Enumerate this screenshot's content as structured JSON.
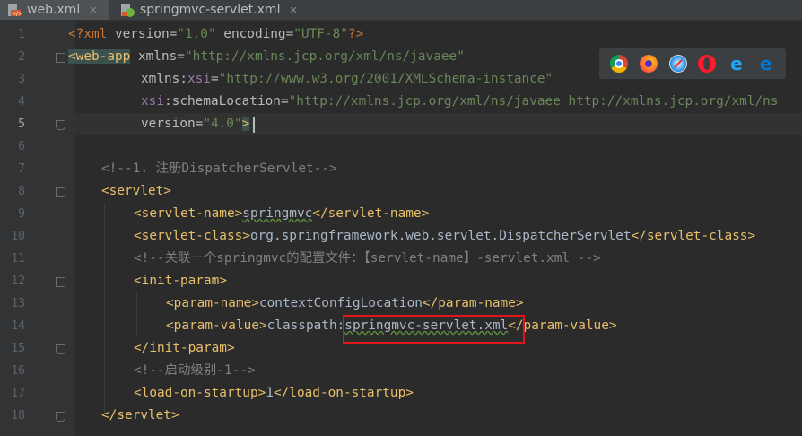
{
  "tabs": [
    {
      "label": "web.xml",
      "active": true
    },
    {
      "label": "springmvc-servlet.xml",
      "active": false
    }
  ],
  "line_numbers": [
    "1",
    "2",
    "3",
    "4",
    "5",
    "6",
    "7",
    "8",
    "9",
    "10",
    "11",
    "12",
    "13",
    "14",
    "15",
    "16",
    "17",
    "18"
  ],
  "current_line": "5",
  "code": {
    "l1": {
      "decl_open": "<?xml ",
      "version_attr": "version=",
      "version_val": "\"1.0\"",
      "encoding_attr": " encoding=",
      "encoding_val": "\"UTF-8\"",
      "decl_close": "?>"
    },
    "l2": {
      "tag": "<web-app",
      "attr": " xmlns=",
      "val": "\"http://xmlns.jcp.org/xml/ns/javaee\""
    },
    "l3": {
      "attr_pre": "xmlns:",
      "attr_ns": "xsi",
      "eq": "=",
      "val": "\"http://www.w3.org/2001/XMLSchema-instance\""
    },
    "l4": {
      "attr_ns": "xsi",
      "attr_rest": ":schemaLocation=",
      "val": "\"http://xmlns.jcp.org/xml/ns/javaee http://xmlns.jcp.org/xml/ns"
    },
    "l5": {
      "attr": "version=",
      "val": "\"4.0\"",
      "close": ">"
    },
    "l7": {
      "comment": "<!--1. 注册DispatcherServlet-->"
    },
    "l8": {
      "tag": "<servlet>"
    },
    "l9": {
      "open": "<servlet-name>",
      "text": "springmvc",
      "close": "</servlet-name>"
    },
    "l10": {
      "open": "<servlet-class>",
      "text": "org.springframework.web.servlet.DispatcherServlet",
      "close": "</servlet-class>"
    },
    "l11": {
      "comment": "<!--关联一个springmvc的配置文件：【servlet-name】-servlet.xml -->"
    },
    "l12": {
      "tag": "<init-param>"
    },
    "l13": {
      "open": "<param-name>",
      "text": "contextConfigLocation",
      "close": "</param-name>"
    },
    "l14": {
      "open": "<param-value>",
      "text_pre": "classpath:",
      "text_hl": "springmvc-servlet.xml",
      "close": "</param-value>"
    },
    "l15": {
      "tag": "</init-param>"
    },
    "l16": {
      "comment": "<!--启动级别-1-->"
    },
    "l17": {
      "open": "<load-on-startup>",
      "text": "1",
      "close": "</load-on-startup>"
    },
    "l18": {
      "tag": "</servlet>"
    }
  },
  "browser_icons": [
    "chrome-icon",
    "firefox-icon",
    "safari-icon",
    "opera-icon",
    "ie-icon",
    "edge-icon"
  ],
  "colors": {
    "tag": "#e8bf6a",
    "value": "#6a8759",
    "comment": "#808080",
    "namespace": "#9876aa",
    "highlight_box": "#e0161a"
  }
}
